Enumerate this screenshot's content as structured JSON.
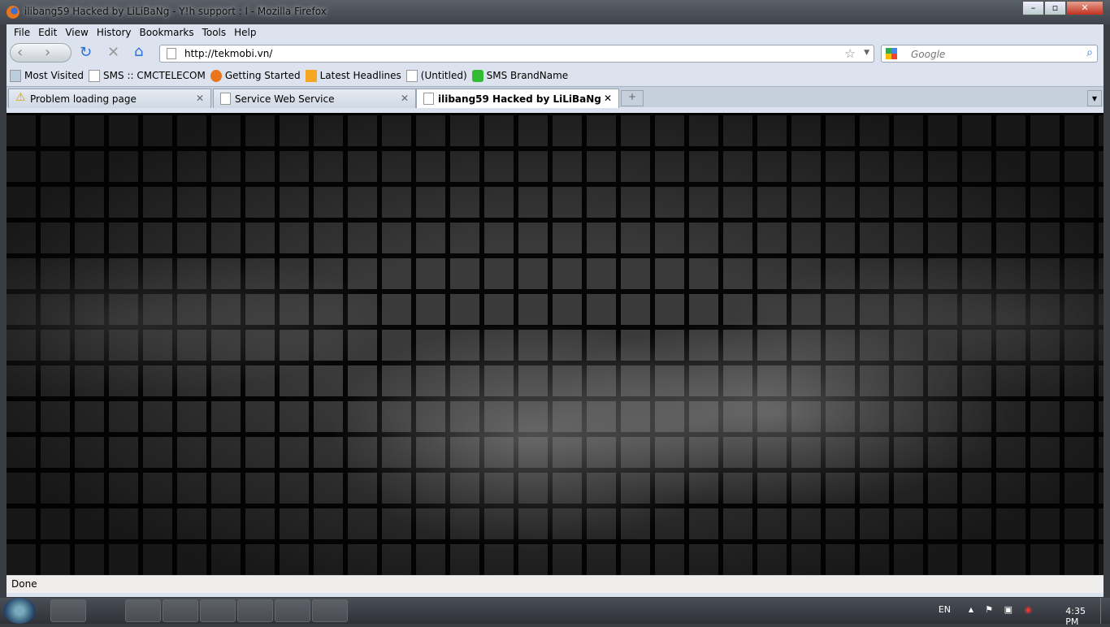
{
  "window": {
    "title": "ilibang59 Hacked by LiLiBaNg - Y!h support : l - Mozilla Firefox"
  },
  "menu": [
    "File",
    "Edit",
    "View",
    "History",
    "Bookmarks",
    "Tools",
    "Help"
  ],
  "address": {
    "url": "http://tekmobi.vn/"
  },
  "search": {
    "placeholder": "Google"
  },
  "bookmarks": [
    {
      "label": "Most Visited",
      "icon": "most-visited-icon"
    },
    {
      "label": "SMS :: CMCTELECOM",
      "icon": "page-icon"
    },
    {
      "label": "Getting Started",
      "icon": "firefox-icon"
    },
    {
      "label": "Latest Headlines",
      "icon": "rss-icon"
    },
    {
      "label": "(Untitled)",
      "icon": "page-icon"
    },
    {
      "label": "SMS BrandName",
      "icon": "sms-icon"
    }
  ],
  "tabs": [
    {
      "label": "Problem loading page",
      "icon": "warning-icon"
    },
    {
      "label": "Service Web Service",
      "icon": "page-icon"
    },
    {
      "label": "ilibang59 Hacked by LiLiBaNg - Y!...",
      "icon": "page-icon",
      "active": true
    }
  ],
  "status": "Done",
  "tray": {
    "lang": "EN",
    "time": "4:35 PM"
  }
}
